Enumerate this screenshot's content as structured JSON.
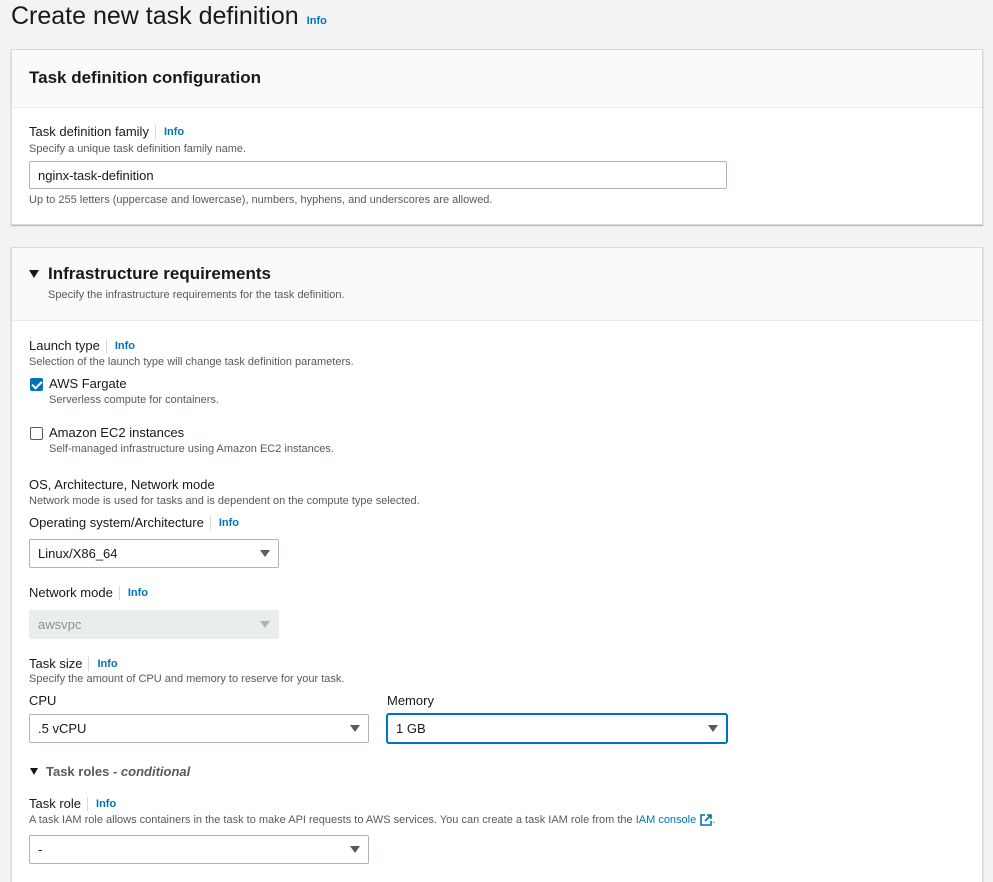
{
  "page": {
    "title": "Create new task definition",
    "info": "Info"
  },
  "task_config": {
    "title": "Task definition configuration",
    "family_label": "Task definition family",
    "family_info": "Info",
    "family_desc": "Specify a unique task definition family name.",
    "family_value": "nginx-task-definition",
    "family_hint": "Up to 255 letters (uppercase and lowercase), numbers, hyphens, and underscores are allowed."
  },
  "infra": {
    "title": "Infrastructure requirements",
    "subtitle": "Specify the infrastructure requirements for the task definition.",
    "launch_type_label": "Launch type",
    "launch_type_info": "Info",
    "launch_type_desc": "Selection of the launch type will change task definition parameters.",
    "options": [
      {
        "label": "AWS Fargate",
        "desc": "Serverless compute for containers.",
        "checked": true
      },
      {
        "label": "Amazon EC2 instances",
        "desc": "Self-managed infrastructure using Amazon EC2 instances.",
        "checked": false
      }
    ],
    "os_section_label": "OS, Architecture, Network mode",
    "os_section_desc": "Network mode is used for tasks and is dependent on the compute type selected.",
    "os_label": "Operating system/Architecture",
    "os_info": "Info",
    "os_value": "Linux/X86_64",
    "network_label": "Network mode",
    "network_info": "Info",
    "network_value": "awsvpc",
    "task_size_label": "Task size",
    "task_size_info": "Info",
    "task_size_desc": "Specify the amount of CPU and memory to reserve for your task.",
    "cpu_label": "CPU",
    "cpu_value": ".5 vCPU",
    "memory_label": "Memory",
    "memory_value": "1 GB",
    "roles_label": "Task roles - ",
    "roles_conditional": "conditional",
    "role_label": "Task role",
    "role_info": "Info",
    "role_desc": "A task IAM role allows containers in the task to make API requests to AWS services. You can create a task IAM role from the ",
    "role_link": "IAM console",
    "role_desc_end": ".",
    "role_value": "-"
  },
  "colors": {
    "accent": "#0073bb",
    "background": "#f2f3f3",
    "text": "#16191f"
  }
}
